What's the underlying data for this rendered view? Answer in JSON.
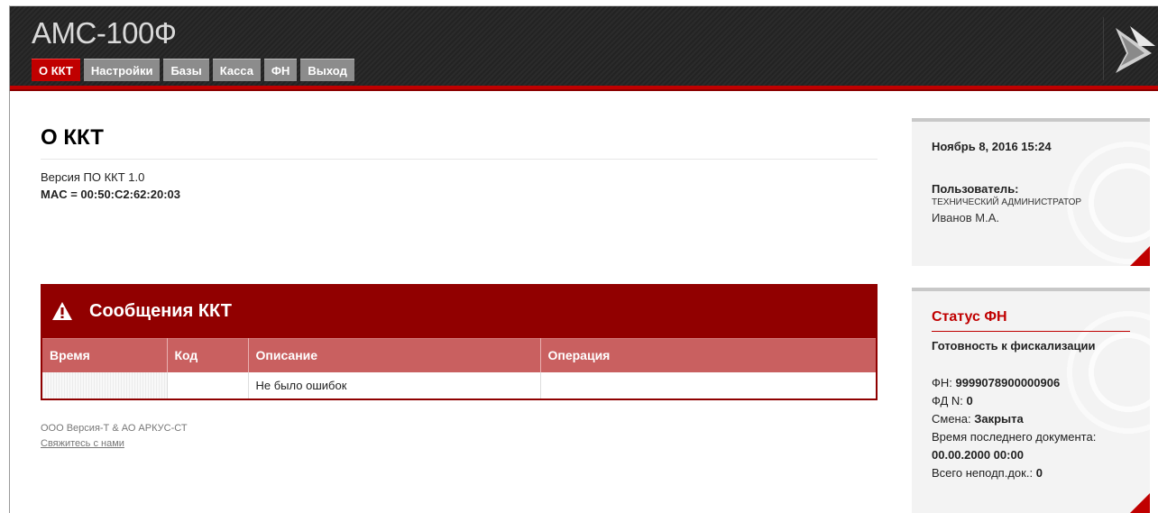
{
  "header": {
    "title": "АМС-100Ф",
    "tabs": [
      {
        "label": "О ККТ",
        "active": true
      },
      {
        "label": "Настройки",
        "active": false
      },
      {
        "label": "Базы",
        "active": false
      },
      {
        "label": "Касса",
        "active": false
      },
      {
        "label": "ФН",
        "active": false
      },
      {
        "label": "Выход",
        "active": false
      }
    ],
    "accent_color": "#c00000"
  },
  "main": {
    "page_title": "О ККТ",
    "version_text": "Версия ПО ККТ 1.0",
    "mac_text": "MAC = 00:50:C2:62:20:03",
    "messages": {
      "title": "Сообщения ККТ",
      "icon": "warning-icon",
      "columns": [
        "Время",
        "Код",
        "Описание",
        "Операция"
      ],
      "rows": [
        [
          "",
          "",
          "Не было ошибок",
          ""
        ]
      ]
    }
  },
  "footer": {
    "company": "ООО Версия-Т & АО АРКУС-СТ",
    "contact_link": "Свяжитесь с нами"
  },
  "sidebar": {
    "datetime": "Ноябрь 8, 2016 15:24",
    "user_label": "Пользователь:",
    "user_role": "ТЕХНИЧЕСКИЙ АДМИНИСТРАТОР",
    "user_name": "Иванов М.А.",
    "fn_status": {
      "title": "Статус ФН",
      "state": "Готовность к фискализации",
      "fn_label": "ФН:",
      "fn_value": "9999078900000906",
      "fd_label": "ФД N:",
      "fd_value": "0",
      "shift_label": "Смена:",
      "shift_value": "Закрыта",
      "last_doc_label": "Время последнего документа:",
      "last_doc_value": "00.00.2000 00:00",
      "unsent_label": "Всего неподп.док.:",
      "unsent_value": "0"
    }
  }
}
